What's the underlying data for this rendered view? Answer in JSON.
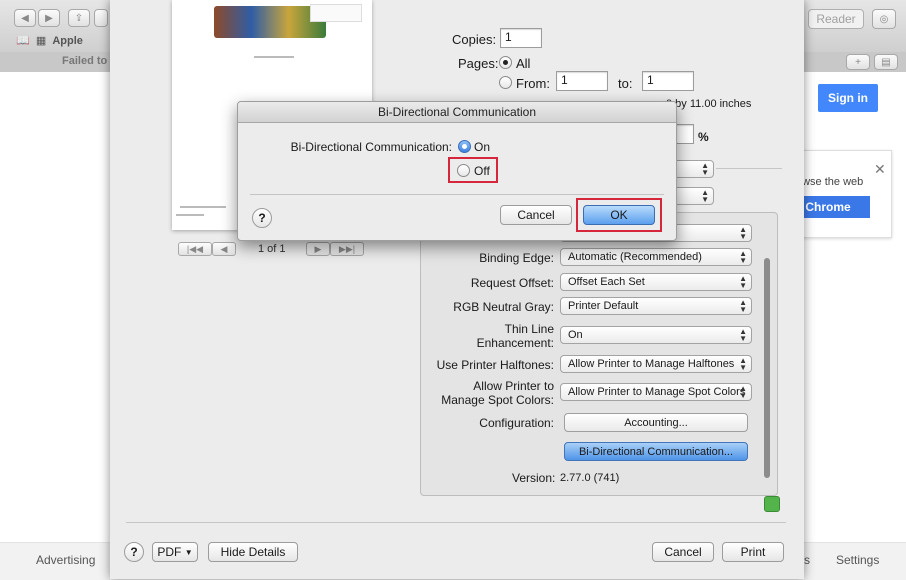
{
  "browser": {
    "reader_label": "Reader",
    "bookmark_label": "Apple",
    "failed_tab_text": "Failed to",
    "sign_in_label": "Sign in",
    "promo_text": "owse the web",
    "chrome_label": "Chrome",
    "footer_left": "Advertising",
    "footer_mid": "s",
    "footer_right": "Settings"
  },
  "print": {
    "copies_label": "Copies:",
    "copies_value": "1",
    "pages_label": "Pages:",
    "pages_all_label": "All",
    "pages_from_label": "From:",
    "pages_from_value": "1",
    "pages_to_label": "to:",
    "pages_to_value": "1",
    "paper_size_partial": "0 by 11.00 inches",
    "scale_unit": "%",
    "page_indicator": "1 of 1",
    "settings": [
      {
        "label": "Binding Edge:",
        "value": "Automatic (Recommended)"
      },
      {
        "label": "Request Offset:",
        "value": "Offset Each Set"
      },
      {
        "label": "RGB Neutral Gray:",
        "value": "Printer Default"
      },
      {
        "label": "Thin Line Enhancement:",
        "value": "On"
      },
      {
        "label": "Use Printer Halftones:",
        "value": "Allow Printer to Manage Halftones"
      },
      {
        "label": "Allow Printer to Manage Spot Colors:",
        "value": "Allow Printer to Manage Spot Colors"
      }
    ],
    "thin_line_1": "Thin Line",
    "thin_line_2": "Enhancement:",
    "allow_spot_1": "Allow Printer to",
    "allow_spot_2": "Manage Spot Colors:",
    "configuration_label": "Configuration:",
    "accounting_label": "Accounting...",
    "bidi_button_label": "Bi-Directional Communication...",
    "version_label": "Version:",
    "version_value": "2.77.0 (741)",
    "help_label": "?",
    "pdf_label": "PDF",
    "hide_details_label": "Hide Details",
    "cancel_label": "Cancel",
    "print_label": "Print"
  },
  "dialog": {
    "title": "Bi-Directional Communication",
    "field_label": "Bi-Directional Communication:",
    "on_label": "On",
    "off_label": "Off",
    "selected": "On",
    "help_label": "?",
    "cancel_label": "Cancel",
    "ok_label": "OK",
    "highlight_color": "#d6263b"
  }
}
